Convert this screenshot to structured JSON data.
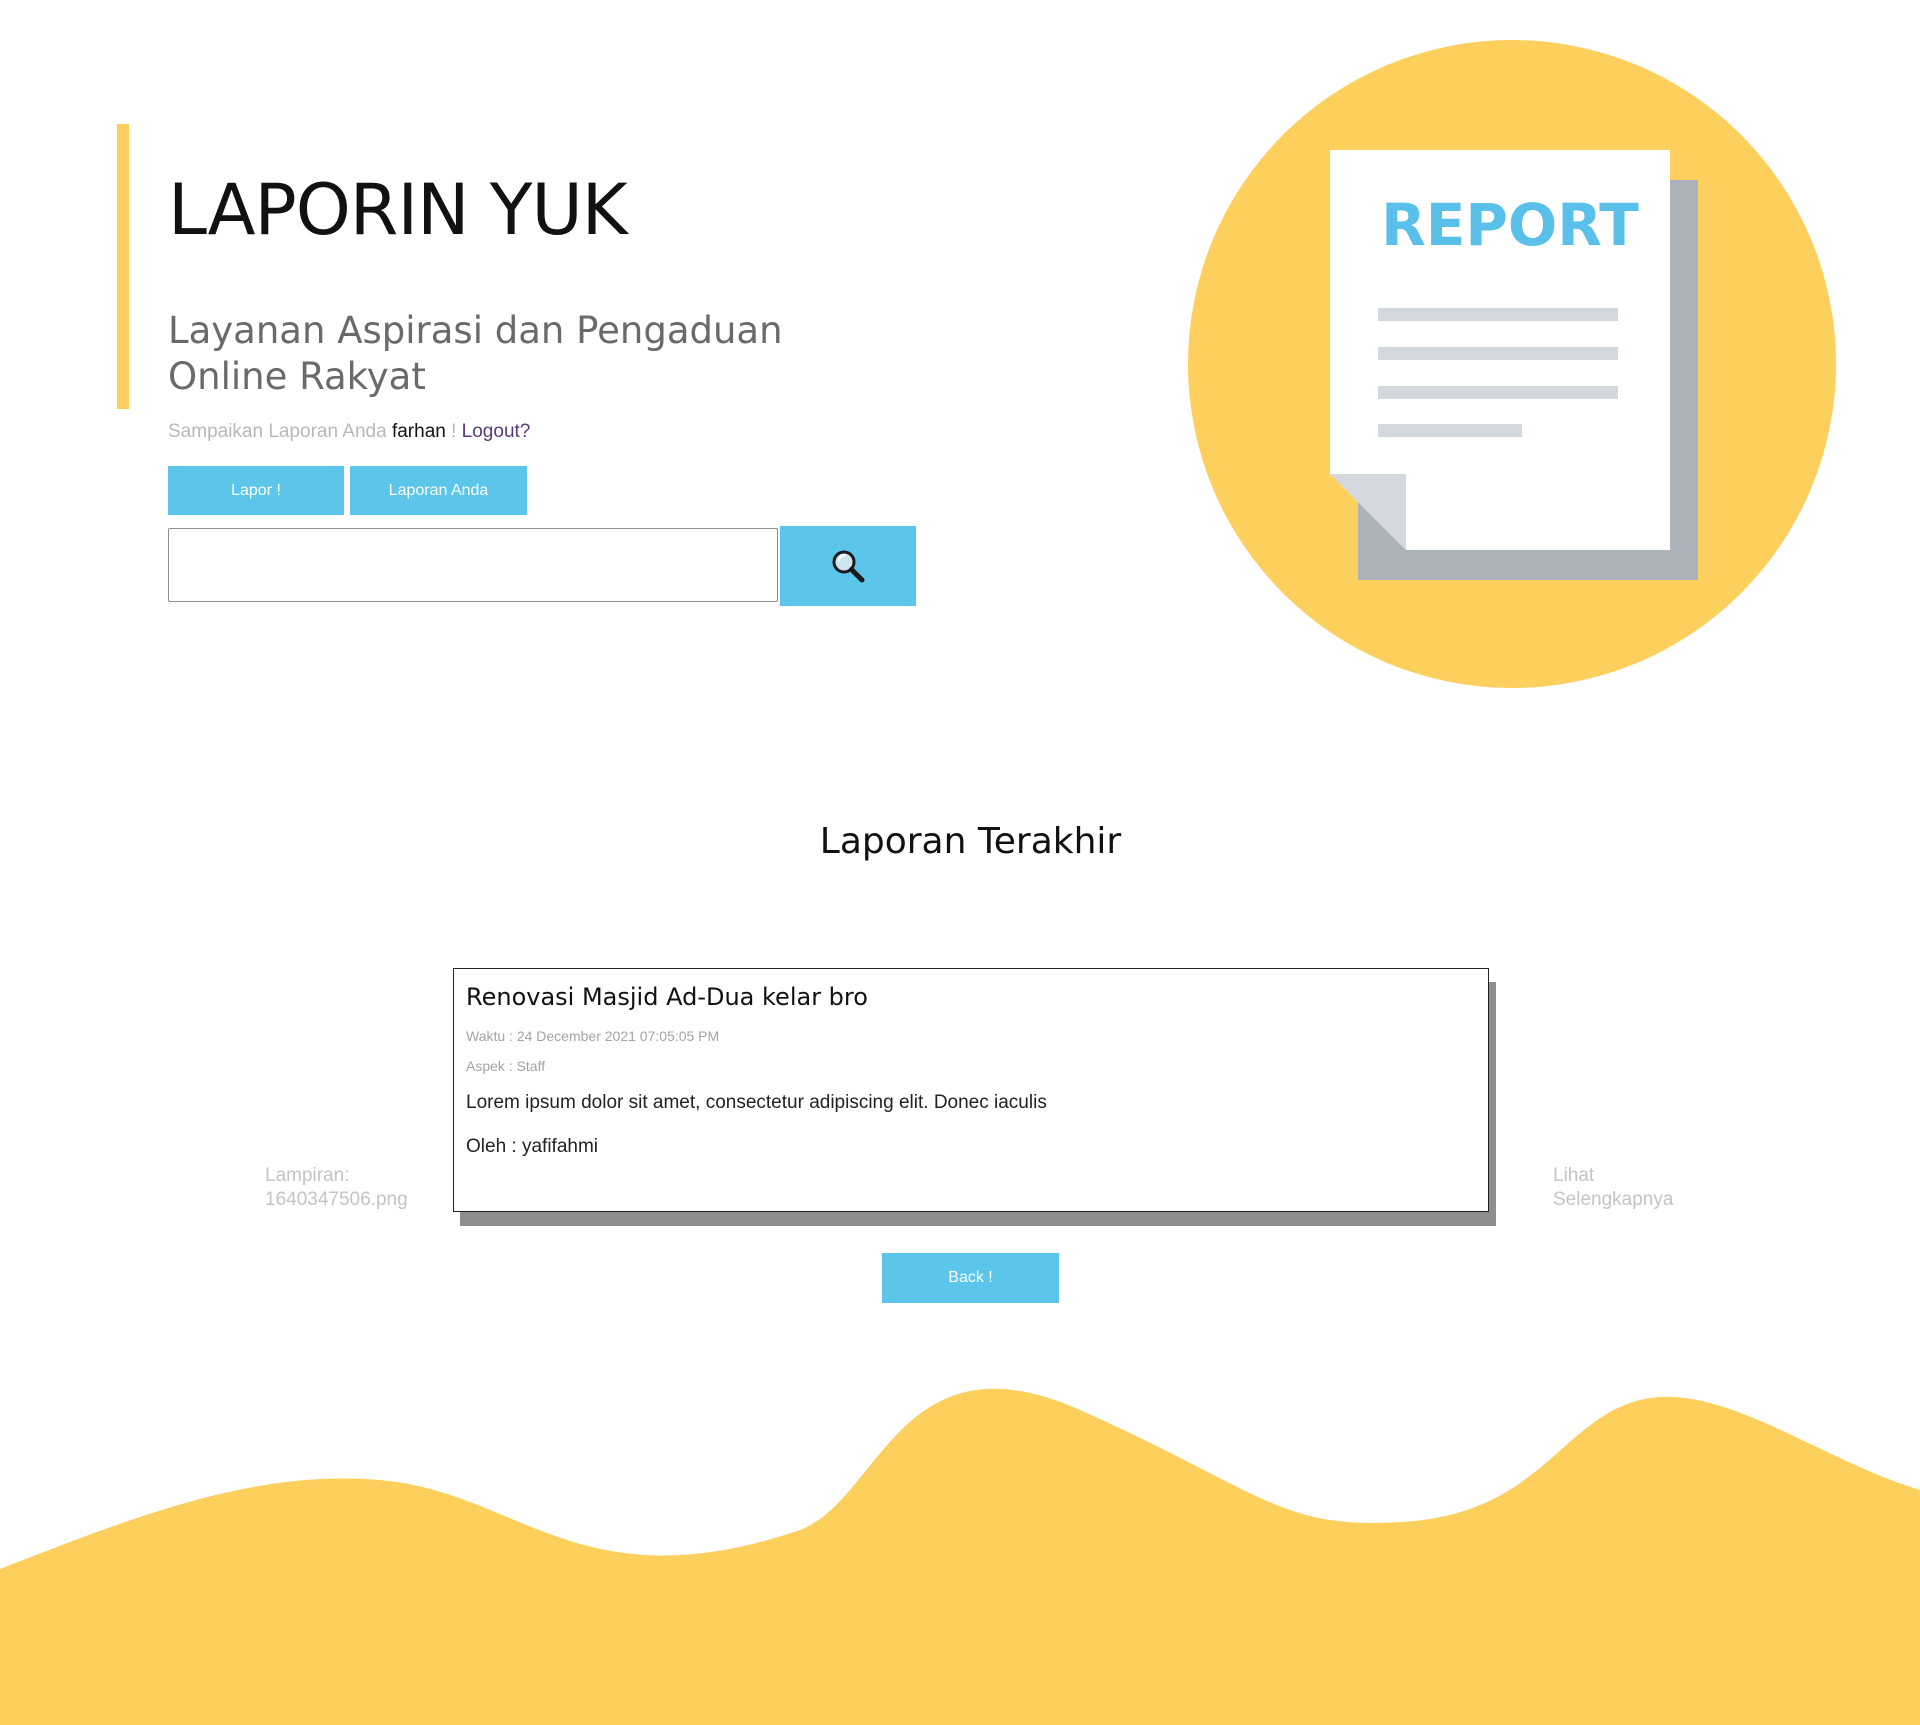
{
  "hero": {
    "title": "LAPORIN YUK",
    "subtitle": "Layanan Aspirasi dan Pengaduan Online Rakyat",
    "welcome_prefix": "Sampaikan Laporan Anda",
    "username": "farhan",
    "exclaim": "!",
    "logout_label": "Logout?",
    "buttons": {
      "lapor_label": "Lapor !",
      "laporan_anda_label": "Laporan Anda"
    },
    "search": {
      "value": "",
      "icon": "search-icon"
    }
  },
  "illustration": {
    "label": "REPORT",
    "icon": "report-document-icon"
  },
  "latest": {
    "section_title": "Laporan Terakhir",
    "attachment_label": "Lampiran: 1640347506.png",
    "read_more_label": "Lihat Selengkapnya",
    "report": {
      "title": "Renovasi Masjid Ad-Dua kelar bro",
      "time": "Waktu : 24 December 2021 07:05:05 PM",
      "aspect": "Aspek : Staff",
      "body": "Lorem ipsum dolor sit amet, consectetur adipiscing elit. Donec iaculis",
      "author": "Oleh : yafifahmi"
    },
    "back_label": "Back !"
  },
  "colors": {
    "accent_yellow": "#FDD05D",
    "button_blue": "#5BC5EA",
    "report_blue": "#59C0E9",
    "logout_purple": "#5b3a78"
  }
}
